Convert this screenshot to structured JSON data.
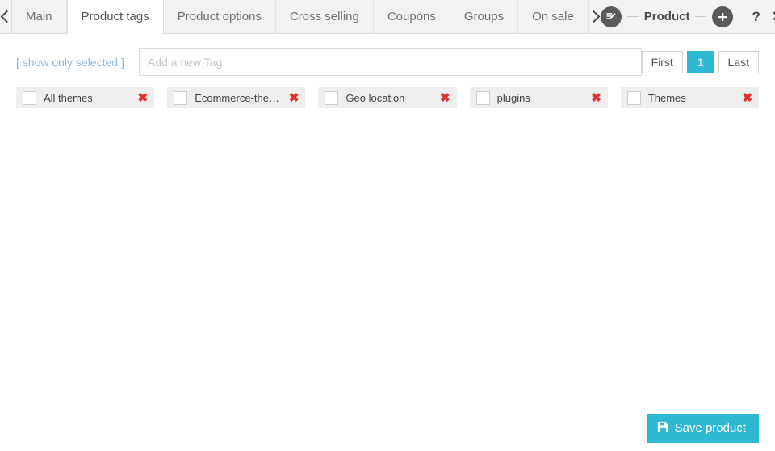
{
  "topbar": {
    "prev_arrow": "chevron-left",
    "next_arrow": "chevron-right",
    "tabs": [
      {
        "label": "Main",
        "active": false
      },
      {
        "label": "Product tags",
        "active": true
      },
      {
        "label": "Product options",
        "active": false
      },
      {
        "label": "Cross selling",
        "active": false
      },
      {
        "label": "Coupons",
        "active": false
      },
      {
        "label": "Groups",
        "active": false
      },
      {
        "label": "On sale",
        "active": false
      }
    ],
    "module_title": "Product",
    "edit_icon": "edit-pencil-icon",
    "add_icon": "plus-icon",
    "help_label": "?",
    "close_label": "✕"
  },
  "toolbar": {
    "show_only_selected": "[ show only selected ]",
    "tag_input_value": "",
    "tag_input_placeholder": "Add a new Tag",
    "pager": {
      "first_label": "First",
      "current_page": "1",
      "last_label": "Last"
    }
  },
  "tags": [
    {
      "label": "All themes",
      "checked": false,
      "remove": "✖"
    },
    {
      "label": "Ecommerce-themes",
      "checked": false,
      "remove": "✖"
    },
    {
      "label": "Geo location",
      "checked": false,
      "remove": "✖"
    },
    {
      "label": "plugins",
      "checked": false,
      "remove": "✖"
    },
    {
      "label": "Themes",
      "checked": false,
      "remove": "✖"
    }
  ],
  "footer": {
    "save_label": "Save product",
    "save_icon": "save-disk-icon"
  },
  "colors": {
    "accent": "#2eb8d4",
    "link": "#8fb8d8",
    "danger": "#e03030",
    "chip_bg": "#eeeeee",
    "topbar_bg": "#f2f2f2"
  }
}
